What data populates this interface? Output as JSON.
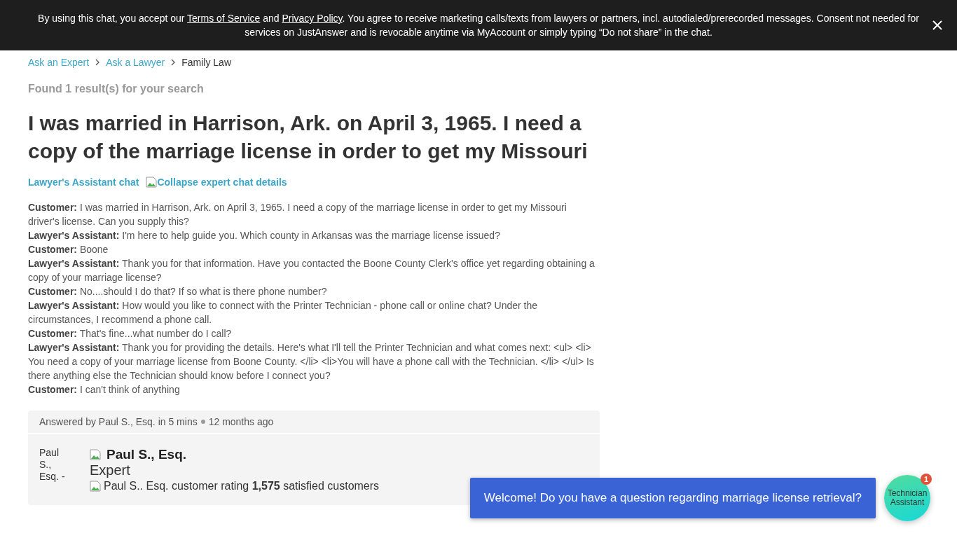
{
  "consent_banner": {
    "text_before": "By using this chat, you accept our",
    "terms_link": "Terms of Service",
    "and": "and",
    "privacy_link": "Privacy Policy",
    "text_after": ". You agree to receive marketing calls/texts from lawyers or partners, incl. autodialed/prerecorded messages. Consent not needed for services on JustAnswer and is revocable anytime via MyAccount or simply typing “Do not share” in the chat."
  },
  "breadcrumbs": [
    {
      "label": "Ask an Expert",
      "kind": "link"
    },
    {
      "label": "Ask a Lawyer",
      "kind": "link"
    },
    {
      "label": "Family Law",
      "kind": "current"
    }
  ],
  "result_count": "Found 1 result(s) for your search",
  "question_title": "I was married in Harrison, Ark. on April 3, 1965. I need a copy of the marriage license in order to get my Missouri",
  "chat_header": {
    "title": "Lawyer's Assistant chat",
    "toggle_alt": "Collapse expert chat details"
  },
  "chat_lines": [
    "**Customer:** I was married in Harrison, Ark. on April 3, 1965. I need a copy of the marriage license in order to get my Missouri driver's license. Can you supply this?",
    "**Lawyer's Assistant:** I'm here to help guide you. Which county in Arkansas was the marriage license issued?",
    "**Customer:** Boone",
    "**Lawyer's Assistant:** Thank you for that information. Have you contacted the Boone County Clerk's office yet regarding obtaining a copy of your marriage license?",
    "**Customer:** No....should I do that? If so what is there phone number?",
    "**Lawyer's Assistant:** How would you like to connect with the Printer Technician - phone call or online chat? Under the circumstances, I recommend a phone call.",
    "**Customer:** That's fine...what number do I call?",
    "**Lawyer's Assistant:** Thank you for providing the details. Here's what I'll tell the Printer Technician and what comes next: <ul> <li> You need a copy of your marriage license from Boone County. </li> <li>You will have a phone call with the Technician. </li> </ul> Is there anything else the Technician should know before I connect you?",
    "**Customer:** I can't think of anything"
  ],
  "answer": {
    "answered_by": "Answered by Paul S., Esq. in 5 mins",
    "age": "12 months ago",
    "avatar_alt": "Paul S., Esq. -",
    "name": "Paul S., Esq.",
    "role": "Expert",
    "rating_alt": "Paul S.. Esq. customer rating",
    "satisfied_count": "1,575",
    "satisfied_label": "satisfied customers"
  },
  "chat_widget": {
    "message": "Welcome! Do you have a question regarding marriage license retrieval?",
    "avatar_alt": "Technician Assistant",
    "badge": "1"
  }
}
